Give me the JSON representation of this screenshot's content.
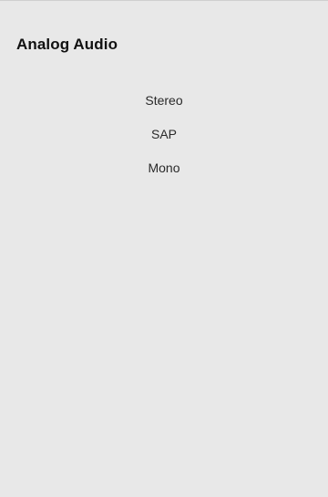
{
  "screen": {
    "title": "Analog Audio"
  },
  "options": [
    {
      "label": "Stereo"
    },
    {
      "label": "SAP"
    },
    {
      "label": "Mono"
    }
  ]
}
